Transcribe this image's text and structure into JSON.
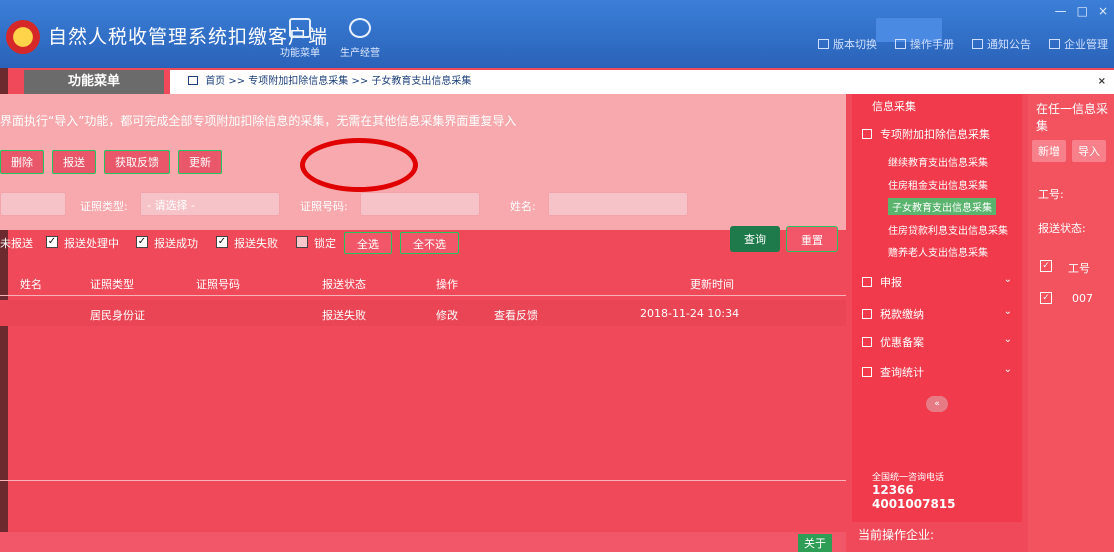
{
  "window": {
    "title": "自然人税收管理系统扣缴客户端",
    "controls": [
      "—",
      "□",
      "×"
    ]
  },
  "toolbar": {
    "tools": [
      {
        "label": "功能菜单",
        "icon": "menu-icon"
      },
      {
        "label": "生产经营",
        "icon": "business-icon"
      }
    ],
    "links": [
      {
        "label": "版本切换",
        "icon": "switch-icon"
      },
      {
        "label": "操作手册",
        "icon": "manual-icon"
      },
      {
        "label": "通知公告",
        "icon": "mail-icon"
      },
      {
        "label": "企业管理",
        "icon": "company-icon"
      }
    ]
  },
  "sidebar": {
    "menu_title": "功能菜单"
  },
  "breadcrumb": {
    "text": "首页 >> 专项附加扣除信息采集 >> 子女教育支出信息采集",
    "close": "×"
  },
  "notice": "界面执行“导入”功能，都可完成全部专项附加扣除信息的采集，无需在其他信息采集界面重复导入",
  "actions": [
    "删除",
    "报送",
    "获取反馈",
    "更新"
  ],
  "filters": {
    "id_type_label": "证照类型:",
    "id_type_value": "- 请选择 -",
    "id_no_label": "证照号码:",
    "name_label": "姓名:"
  },
  "status_checks": [
    {
      "label": "未报送",
      "checked": true
    },
    {
      "label": "报送处理中",
      "checked": true
    },
    {
      "label": "报送成功",
      "checked": true
    },
    {
      "label": "报送失败",
      "checked": false
    },
    {
      "label": "锁定",
      "checked": false
    }
  ],
  "select_all": "全选",
  "select_none": "全不选",
  "query": "查询",
  "reset": "重置",
  "table": {
    "columns": [
      "姓名",
      "证照类型",
      "证照号码",
      "报送状态",
      "操作",
      "更新时间"
    ],
    "rows": [
      {
        "name": "",
        "id_type": "居民身份证",
        "id_no": "",
        "status": "报送失败",
        "op1": "修改",
        "op2": "查看反馈",
        "time": "2018-11-24 10:34"
      }
    ]
  },
  "footer": {
    "close": "关于"
  },
  "right_menu": {
    "current": "信息采集",
    "group": "专项附加扣除信息采集",
    "subitems": [
      "继续教育支出信息采集",
      "住房租金支出信息采集",
      "子女教育支出信息采集",
      "住房贷款利息支出信息采集",
      "赡养老人支出信息采集"
    ],
    "groups": [
      "申报",
      "税款缴纳",
      "优惠备案",
      "查询统计"
    ],
    "collapse": "«"
  },
  "hotline": {
    "caption": "全国统一咨询电话",
    "numbers": [
      "12366",
      "4001007815"
    ]
  },
  "current_enterprise": "当前操作企业:",
  "far_panel": {
    "title": "在任一信息采集",
    "buttons": [
      "新增",
      "导入"
    ],
    "job_label": "工号:",
    "status_label": "报送状态:",
    "col_header": "工号",
    "row_value": "007"
  }
}
